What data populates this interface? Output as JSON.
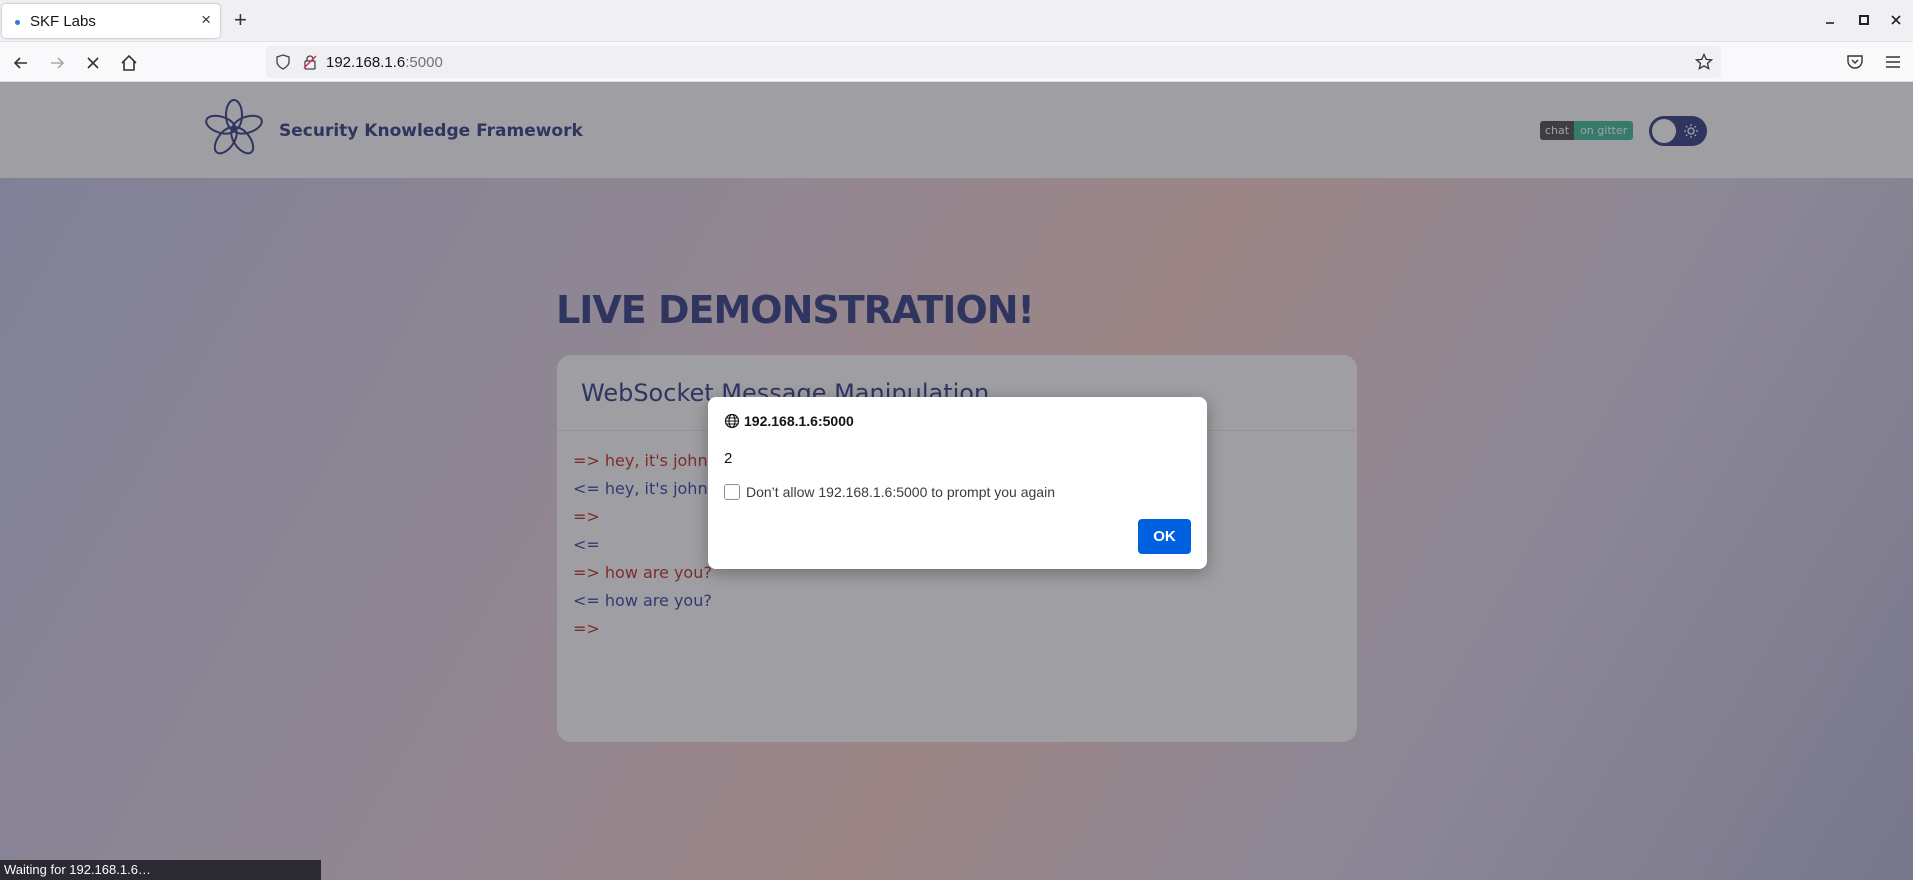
{
  "browser": {
    "tab_title": "SKF Labs",
    "url_host": "192.168.1.6",
    "url_port": ":5000",
    "status_text": "Waiting for 192.168.1.6…"
  },
  "site": {
    "brand": "Security Knowledge Framework",
    "badge_left": "chat",
    "badge_right": "on gitter",
    "headline": "LIVE DEMONSTRATION!",
    "card_title": "WebSocket Message Manipulation",
    "messages": [
      {
        "dir": "out",
        "text": "=> hey, it's john"
      },
      {
        "dir": "in",
        "text": "<= hey, it's john"
      },
      {
        "dir": "out",
        "text": "=>"
      },
      {
        "dir": "in",
        "text": "<="
      },
      {
        "dir": "out",
        "text": "=> how are you?"
      },
      {
        "dir": "in",
        "text": "<= how are you?"
      },
      {
        "dir": "out",
        "text": "=>"
      }
    ]
  },
  "dialog": {
    "origin": "192.168.1.6:5000",
    "message": "2",
    "checkbox_label": "Don’t allow 192.168.1.6:5000 to prompt you again",
    "checkbox_checked": false,
    "ok_label": "OK"
  },
  "colors": {
    "brand": "#3d4588",
    "outgoing": "#c0392b",
    "incoming": "#3d4ea8",
    "ok_button": "#0061e0"
  }
}
